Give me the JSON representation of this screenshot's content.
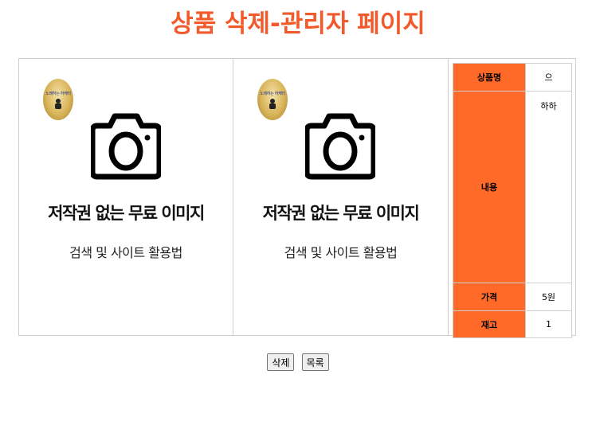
{
  "page": {
    "title": "상품 삭제-관리자 페이지"
  },
  "images": [
    {
      "badge_text": "노래하는 하케터",
      "caption_main": "저작권 없는 무료 이미지",
      "caption_sub": "검색 및 사이트 활용법",
      "icon": "camera-icon"
    },
    {
      "badge_text": "노래하는 하케터",
      "caption_main": "저작권 없는 무료 이미지",
      "caption_sub": "검색 및 사이트 활용법",
      "icon": "camera-icon"
    }
  ],
  "product": {
    "name_label": "상품명",
    "name_value": "으",
    "content_label": "내용",
    "content_value": "하하",
    "price_label": "가격",
    "price_value": "5원",
    "stock_label": "재고",
    "stock_value": "1"
  },
  "actions": {
    "delete_label": "삭제",
    "list_label": "목록"
  },
  "colors": {
    "title": "#f25a2b",
    "header_cell": "#ff6a28"
  }
}
